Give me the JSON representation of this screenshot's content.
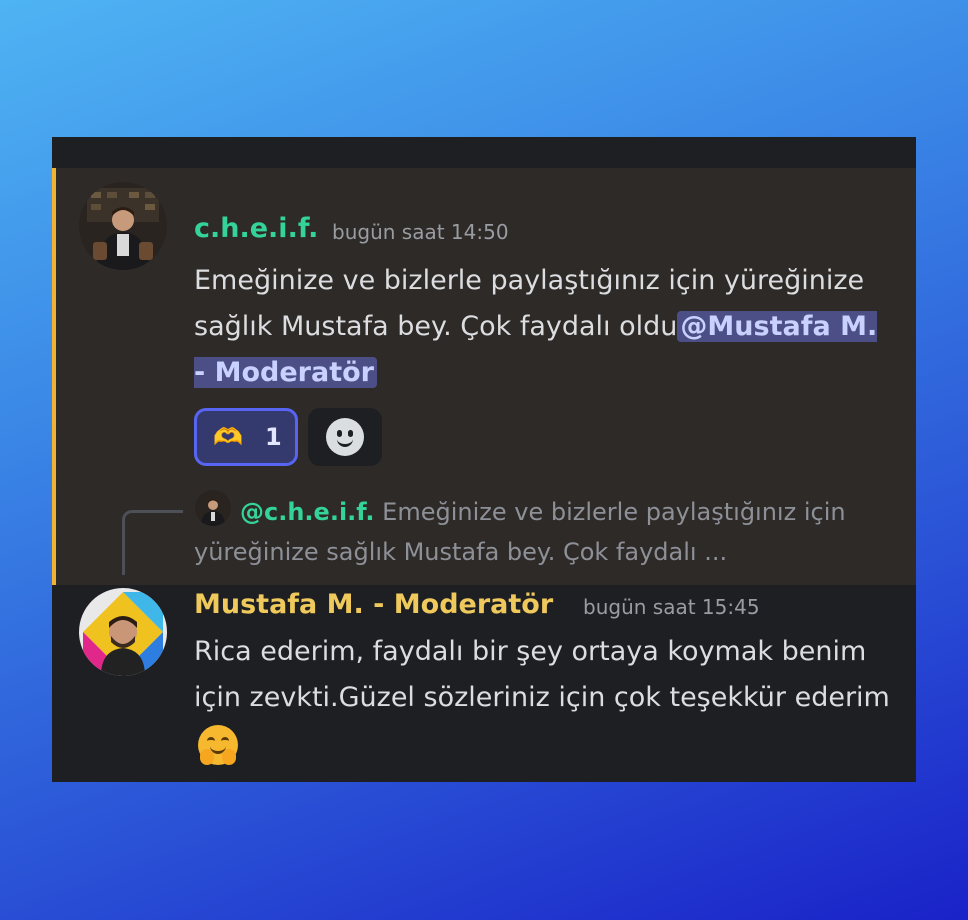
{
  "message1": {
    "author": "c.h.e.i.f.",
    "timestamp": "bugün saat 14:50",
    "text": "Emeğinize ve bizlerle paylaştığınız için yüreğinize sağlık Mustafa bey. Çok faydalı oldu",
    "mention": "@Mustafa M. - Moderatör",
    "reactions": [
      {
        "icon": "heart-hands-icon",
        "glyph": "🫶",
        "count": "1"
      }
    ],
    "add_reaction_icon": "smiley-add-reaction-icon",
    "highlight_color": "#f0b232"
  },
  "message2": {
    "reply": {
      "author": "@c.h.e.i.f.",
      "preview": "Emeğinize ve bizlerle paylaştığınız için yüreğinize sağlık Mustafa bey. Çok faydalı ..."
    },
    "author": "Mustafa M. - Moderatör",
    "timestamp": "bugün saat 15:45",
    "text": "Rica ederim, faydalı bir şey ortaya koymak benim için zevkti.Güzel sözleriniz için çok teşekkür ederim",
    "emoji_icon": "hugging-face-icon"
  },
  "colors": {
    "author1": "#34d39a",
    "author2": "#f0c95c",
    "mention_bg": "#4b4f86",
    "reaction_border": "#5865f2"
  }
}
